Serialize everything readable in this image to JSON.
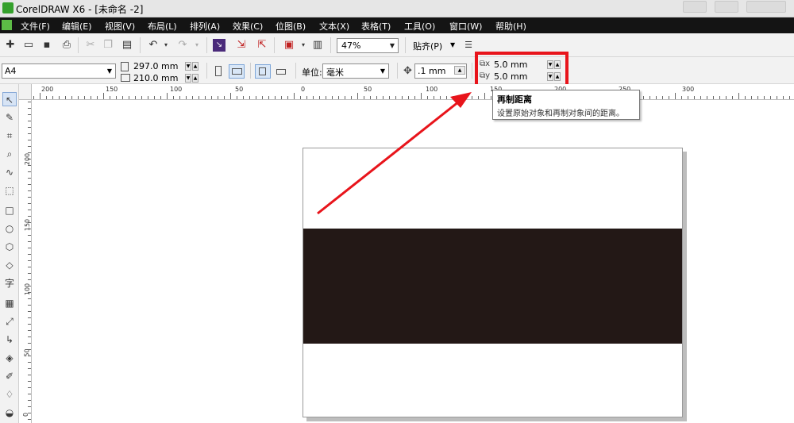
{
  "window": {
    "title": "CorelDRAW X6 - [未命名 -2]"
  },
  "menu": [
    "文件(F)",
    "编辑(E)",
    "视图(V)",
    "布局(L)",
    "排列(A)",
    "效果(C)",
    "位图(B)",
    "文本(X)",
    "表格(T)",
    "工具(O)",
    "窗口(W)",
    "帮助(H)"
  ],
  "toolbar1": {
    "zoom": "47%",
    "snap_label": "贴齐(P)"
  },
  "toolbar2": {
    "page_size": "A4",
    "width": "297.0 mm",
    "height": "210.0 mm",
    "unit_label": "单位:",
    "unit": "毫米",
    "nudge": ".1 mm",
    "dup_x": "5.0 mm",
    "dup_y": "5.0 mm"
  },
  "tooltip": {
    "title": "再制距离",
    "description": "设置原始对象和再制对象间的距离。"
  },
  "ruler_h": [
    "200",
    "150",
    "100",
    "50",
    "0",
    "50",
    "100",
    "150",
    "200",
    "250",
    "300"
  ],
  "ruler_v": [
    "200",
    "150",
    "100",
    "50",
    "0"
  ],
  "toolbox": {
    "text_tool_glyph": "字"
  },
  "colors": {
    "accent_red": "#e8141b",
    "black_rect": "#231816",
    "menu_bg": "#141414"
  }
}
